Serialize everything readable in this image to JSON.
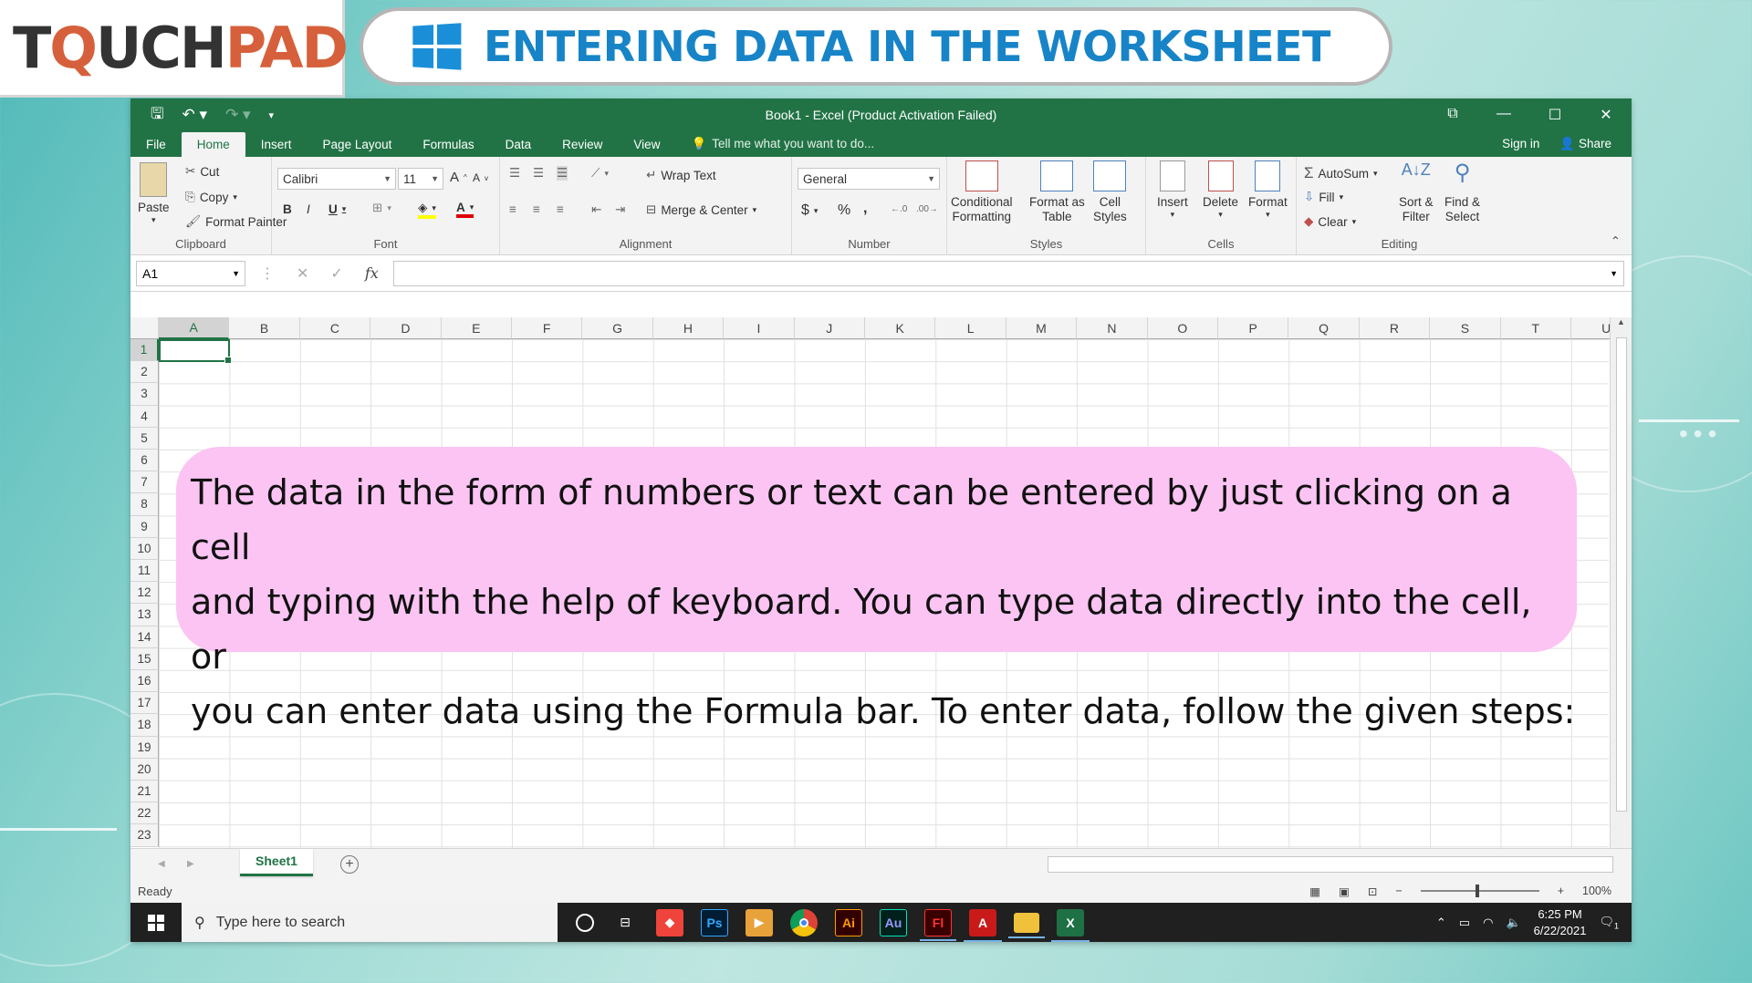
{
  "header": {
    "logo": {
      "part1": "T",
      "part2": "Q",
      "part3": "UCH",
      "part4": "PAD"
    },
    "title": "ENTERING DATA IN THE WORKSHEET"
  },
  "excel": {
    "window_title": "Book1 - Excel (Product Activation Failed)",
    "tabs": [
      "File",
      "Home",
      "Insert",
      "Page Layout",
      "Formulas",
      "Data",
      "Review",
      "View"
    ],
    "active_tab": "Home",
    "tell_me": "Tell me what you want to do...",
    "sign_in": "Sign in",
    "share": "Share",
    "ribbon": {
      "clipboard": {
        "label": "Clipboard",
        "paste": "Paste",
        "cut": "Cut",
        "copy": "Copy",
        "format_painter": "Format Painter"
      },
      "font": {
        "label": "Font",
        "font_name": "Calibri",
        "font_size": "11",
        "bold": "B",
        "italic": "I",
        "underline": "U"
      },
      "alignment": {
        "label": "Alignment",
        "wrap_text": "Wrap Text",
        "merge_center": "Merge & Center"
      },
      "number": {
        "label": "Number",
        "format": "General",
        "currency": "$",
        "percent": "%",
        "comma": ","
      },
      "styles": {
        "label": "Styles",
        "conditional_1": "Conditional",
        "conditional_2": "Formatting",
        "format_as_1": "Format as",
        "format_as_2": "Table",
        "cell_styles_1": "Cell",
        "cell_styles_2": "Styles"
      },
      "cells": {
        "label": "Cells",
        "insert": "Insert",
        "delete": "Delete",
        "format": "Format"
      },
      "editing": {
        "label": "Editing",
        "autosum": "AutoSum",
        "fill": "Fill",
        "clear": "Clear",
        "sort_1": "Sort &",
        "sort_2": "Filter",
        "find_1": "Find &",
        "find_2": "Select"
      }
    },
    "name_box": "A1",
    "columns": [
      "A",
      "B",
      "C",
      "D",
      "E",
      "F",
      "G",
      "H",
      "I",
      "J",
      "K",
      "L",
      "M",
      "N",
      "O",
      "P",
      "Q",
      "R",
      "S",
      "T",
      "U"
    ],
    "rows": [
      "1",
      "2",
      "3",
      "4",
      "5",
      "6",
      "7",
      "8",
      "9",
      "10",
      "11",
      "12",
      "13",
      "14",
      "15",
      "16",
      "17",
      "18",
      "19",
      "20",
      "21",
      "22",
      "23"
    ],
    "sheet_tab": "Sheet1",
    "status": "Ready",
    "zoom": "100%"
  },
  "taskbar": {
    "search_placeholder": "Type here to search",
    "time": "6:25 PM",
    "date": "6/22/2021",
    "notification_count": "1",
    "apps": [
      {
        "name": "cortana",
        "label": "O"
      },
      {
        "name": "task-view",
        "label": ""
      },
      {
        "name": "anydesk",
        "label": "◆"
      },
      {
        "name": "photoshop",
        "label": "Ps"
      },
      {
        "name": "media-player",
        "label": "▶"
      },
      {
        "name": "chrome",
        "label": ""
      },
      {
        "name": "illustrator",
        "label": "Ai"
      },
      {
        "name": "audition",
        "label": "Au"
      },
      {
        "name": "flash",
        "label": "Fl"
      },
      {
        "name": "acrobat",
        "label": ""
      },
      {
        "name": "file-explorer",
        "label": ""
      },
      {
        "name": "excel",
        "label": "X"
      }
    ]
  },
  "callout": {
    "line1": "The data in the form of numbers or text can be entered by just clicking on a cell",
    "line2": "and typing with the help of keyboard. You can type data directly into the cell, or",
    "line3": "you can enter data using the Formula bar. To enter data, follow the given steps:"
  },
  "colors": {
    "excel_green": "#217346",
    "callout_pink": "#fbc4f3",
    "title_blue": "#1784c7",
    "logo_orange": "#d6603b"
  }
}
